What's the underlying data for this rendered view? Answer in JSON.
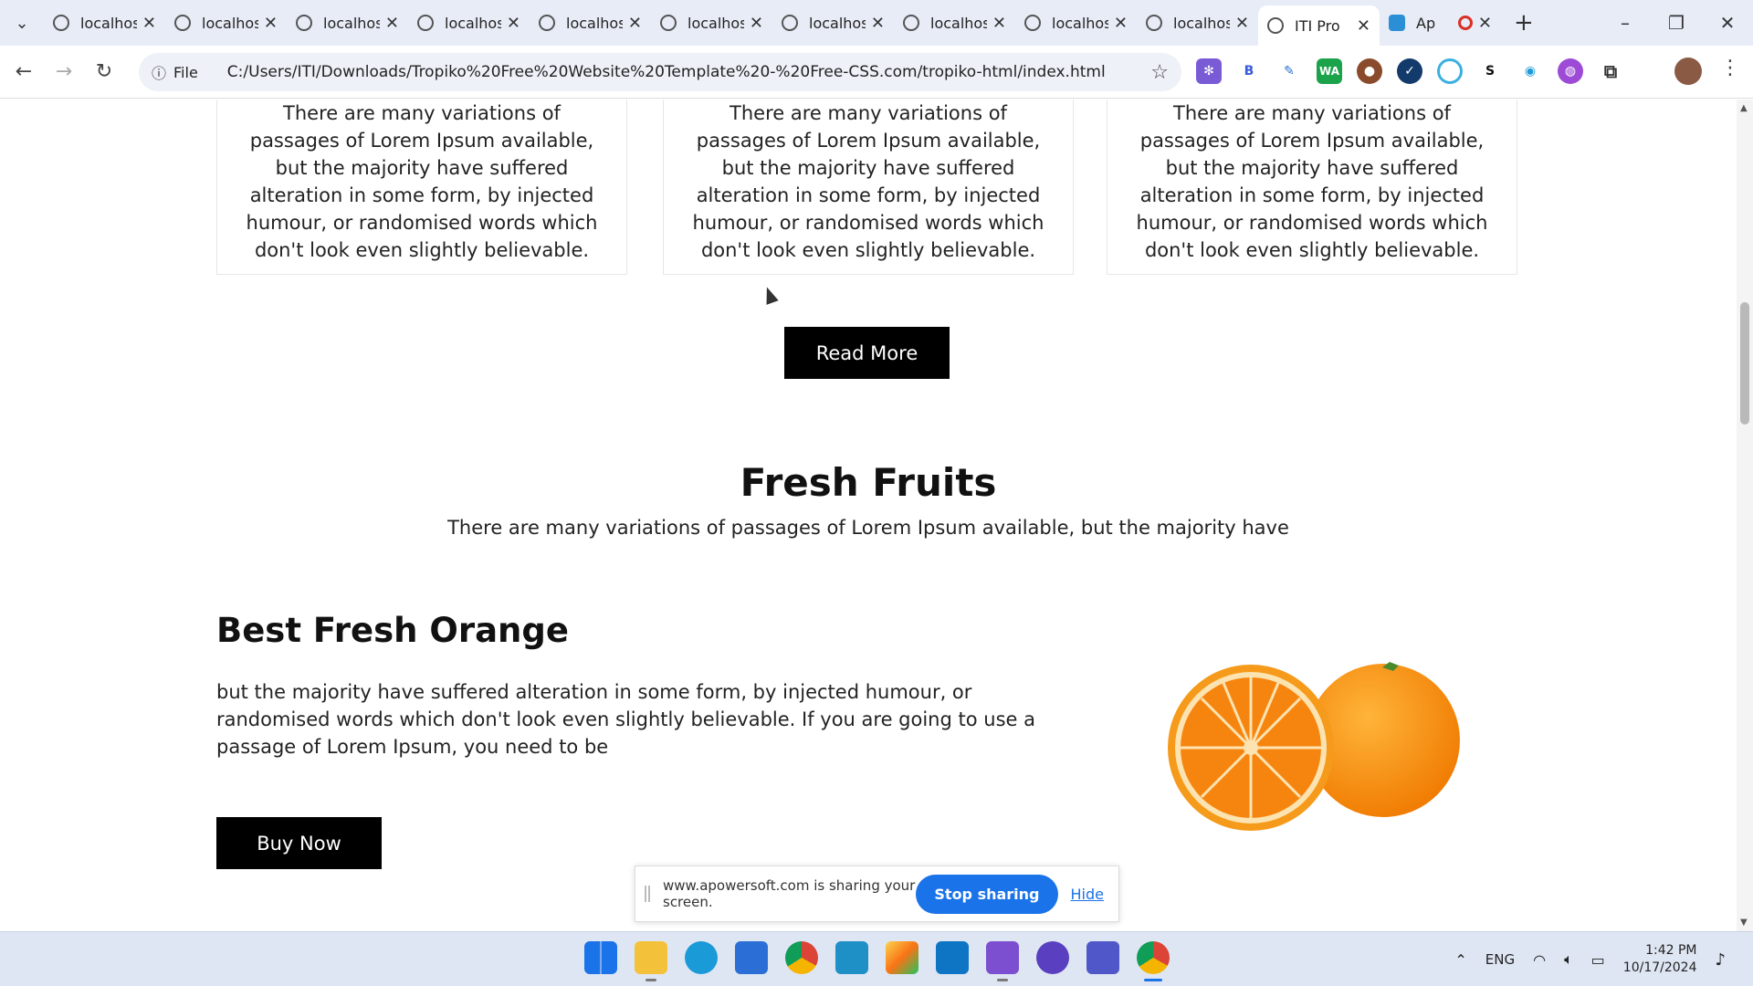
{
  "browser": {
    "tabs": [
      {
        "title": "localhost"
      },
      {
        "title": "localhost"
      },
      {
        "title": "localhost"
      },
      {
        "title": "localhost"
      },
      {
        "title": "localhost"
      },
      {
        "title": "localhost"
      },
      {
        "title": "localhost"
      },
      {
        "title": "localhost"
      },
      {
        "title": "localhost"
      },
      {
        "title": "localhost"
      },
      {
        "title": "ITI Pro",
        "active": true
      },
      {
        "title": "Ap"
      }
    ],
    "scheme_label": "File",
    "url": "C:/Users/ITI/Downloads/Tropiko%20Free%20Website%20Template%20-%20Free-CSS.com/tropiko-html/index.html"
  },
  "page": {
    "card_text": "There are many variations of passages of Lorem Ipsum available, but the majority have suffered alteration in some form, by injected humour, or randomised words which don't look even slightly believable.",
    "read_more_label": "Read More",
    "section_title": "Fresh Fruits",
    "section_subtitle": "There are many variations of passages of Lorem Ipsum available, but the majority have",
    "product_title": "Best Fresh Orange",
    "product_desc": "but the majority have suffered alteration in some form, by injected humour, or randomised words which don't look even slightly believable. If you are going to use a passage of Lorem Ipsum, you need to be",
    "buy_now_label": "Buy Now"
  },
  "share_bar": {
    "message": "www.apowersoft.com is sharing your screen.",
    "stop_label": "Stop sharing",
    "hide_label": "Hide"
  },
  "taskbar": {
    "language": "ENG",
    "time": "1:42 PM",
    "date": "10/17/2024"
  },
  "colors": {
    "button_bg": "#000000",
    "stop_sharing": "#1a73e8",
    "tab_strip": "#e8ecf7"
  }
}
